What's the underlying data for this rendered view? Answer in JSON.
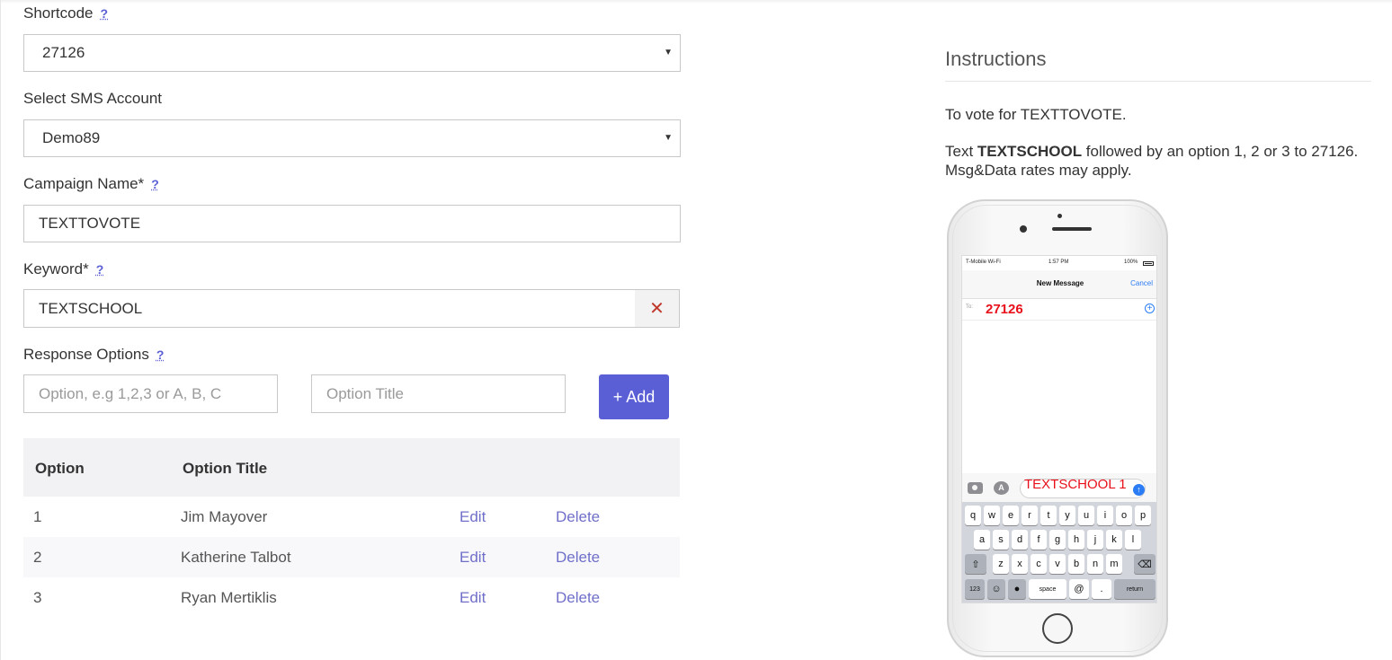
{
  "form": {
    "shortcode_label": "Shortcode",
    "shortcode_value": "27126",
    "sms_account_label": "Select SMS Account",
    "sms_account_value": "Demo89",
    "campaign_name_label": "Campaign Name*",
    "campaign_name_value": "TEXTTOVOTE",
    "keyword_label": "Keyword*",
    "keyword_value": "TEXTSCHOOL",
    "response_options_label": "Response Options",
    "option_placeholder": "Option, e.g 1,2,3 or A, B, C",
    "option_title_placeholder": "Option Title",
    "add_button_label": "+ Add",
    "help_glyph": "?",
    "clear_glyph": "✕",
    "dropdown_glyph": "▼"
  },
  "table": {
    "headers": [
      "Option",
      "Option Title"
    ],
    "rows": [
      {
        "option": "1",
        "title": "Jim Mayover",
        "edit": "Edit",
        "delete": "Delete"
      },
      {
        "option": "2",
        "title": "Katherine Talbot",
        "edit": "Edit",
        "delete": "Delete"
      },
      {
        "option": "3",
        "title": "Ryan Mertiklis",
        "edit": "Edit",
        "delete": "Delete"
      }
    ]
  },
  "instructions": {
    "title": "Instructions",
    "line1": "To vote for TEXTTOVOTE.",
    "line2_prefix": "Text ",
    "line2_keyword": "TEXTSCHOOL",
    "line2_suffix": " followed by an option 1, 2 or 3 to 27126.",
    "line3": "Msg&Data rates may apply."
  },
  "phone": {
    "carrier": "T-Mobile Wi-Fi",
    "time": "1:57 PM",
    "battery": "100%",
    "nav_title": "New Message",
    "cancel": "Cancel",
    "to_label": "To:",
    "recipient": "27126",
    "message_text": "TEXTSCHOOL 1",
    "keyboard": {
      "row1": [
        "q",
        "w",
        "e",
        "r",
        "t",
        "y",
        "u",
        "i",
        "o",
        "p"
      ],
      "row2": [
        "a",
        "s",
        "d",
        "f",
        "g",
        "h",
        "j",
        "k",
        "l"
      ],
      "row3": [
        "z",
        "x",
        "c",
        "v",
        "b",
        "n",
        "m"
      ],
      "shift": "⇧",
      "backspace": "⌫",
      "num": "123",
      "emoji": "☺",
      "mic": "🎙",
      "space": "space",
      "at": "@",
      "dot": ".",
      "return": "return"
    }
  },
  "colors": {
    "accent": "#5a5fd6",
    "link": "#6f6fc9",
    "sms_red": "#e8101a",
    "ios_blue": "#2b7cf5"
  }
}
